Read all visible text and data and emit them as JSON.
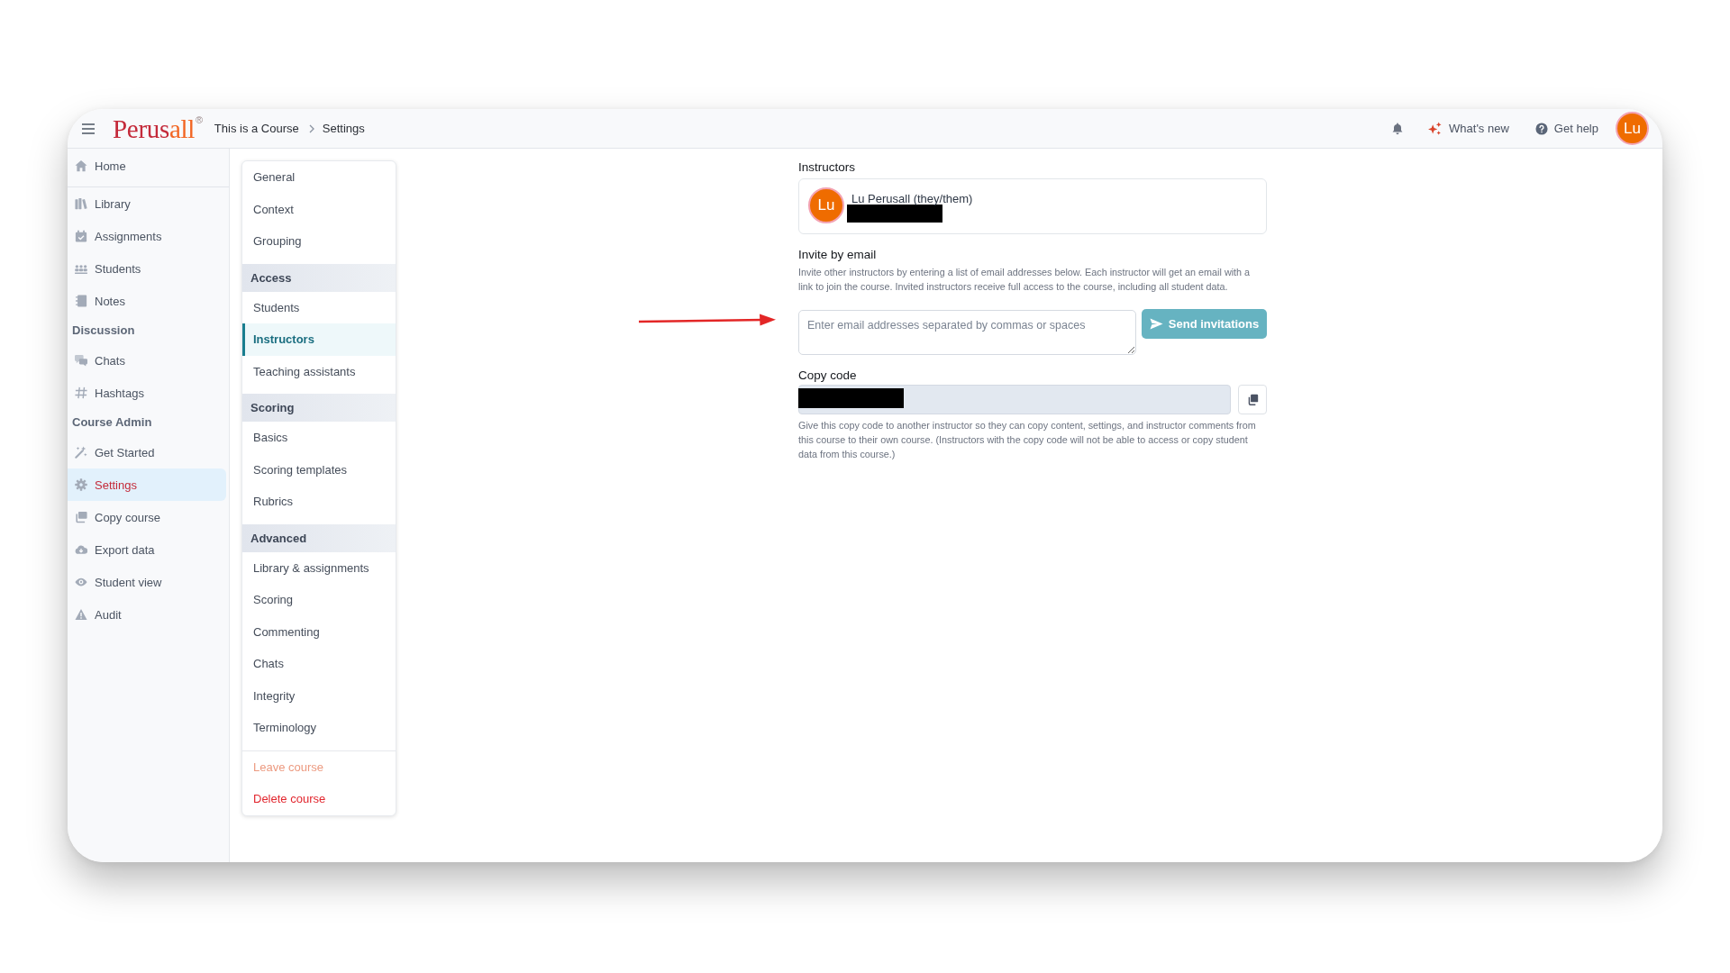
{
  "header": {
    "logo": {
      "primary": "Perus",
      "accent": "all",
      "mark": "®"
    },
    "breadcrumb": [
      "This is a Course",
      "Settings"
    ],
    "whats_new": "What's new",
    "help": "Get help",
    "avatar": "Lu"
  },
  "sidebar": {
    "groups": [
      {
        "items": [
          {
            "label": "Home",
            "selected": false
          }
        ]
      },
      {
        "items": [
          {
            "label": "Library",
            "selected": false
          },
          {
            "label": "Assignments",
            "selected": false
          },
          {
            "label": "Students",
            "selected": false
          },
          {
            "label": "Notes",
            "selected": false
          }
        ]
      },
      {
        "title": "Discussion",
        "items": [
          {
            "label": "Chats",
            "selected": false
          },
          {
            "label": "Hashtags",
            "selected": false
          }
        ]
      },
      {
        "title": "Course Admin",
        "items": [
          {
            "label": "Get Started",
            "selected": false
          },
          {
            "label": "Settings",
            "selected": true
          },
          {
            "label": "Copy course",
            "selected": false
          },
          {
            "label": "Export data",
            "selected": false
          },
          {
            "label": "Student view",
            "selected": false
          },
          {
            "label": "Audit",
            "selected": false
          }
        ]
      }
    ]
  },
  "settings_menu": {
    "sections": [
      {
        "items": [
          {
            "label": "General",
            "selected": false
          },
          {
            "label": "Context",
            "selected": false
          },
          {
            "label": "Grouping",
            "selected": false
          }
        ]
      },
      {
        "title": "Access",
        "items": [
          {
            "label": "Students",
            "selected": false
          },
          {
            "label": "Instructors",
            "selected": true
          },
          {
            "label": "Teaching assistants",
            "selected": false
          }
        ]
      },
      {
        "title": "Scoring",
        "items": [
          {
            "label": "Basics",
            "selected": false
          },
          {
            "label": "Scoring templates",
            "selected": false
          },
          {
            "label": "Rubrics",
            "selected": false
          }
        ]
      },
      {
        "title": "Advanced",
        "items": [
          {
            "label": "Library & assignments",
            "selected": false
          },
          {
            "label": "Scoring",
            "selected": false
          },
          {
            "label": "Commenting",
            "selected": false
          },
          {
            "label": "Chats",
            "selected": false
          },
          {
            "label": "Integrity",
            "selected": false
          },
          {
            "label": "Terminology",
            "selected": false
          }
        ]
      }
    ],
    "actions": [
      {
        "label": "Leave course",
        "kind": "warning"
      },
      {
        "label": "Delete course",
        "kind": "danger"
      }
    ]
  },
  "instructors": {
    "title": "Instructors",
    "members": [
      {
        "initials": "Lu",
        "name": "Lu Perusall (they/them)",
        "email_redacted": true
      }
    ]
  },
  "invite": {
    "title": "Invite by email",
    "description": "Invite other instructors by entering a list of email addresses below. Each instructor will get an email with a link to join the course. Invited instructors receive full access to the course, including all student data.",
    "field": {
      "placeholder": "Enter email addresses separated by commas or spaces"
    },
    "button": {
      "label": "Send invitations",
      "disabled": true
    }
  },
  "copy_code": {
    "title": "Copy code",
    "value_redacted": true,
    "description": "Give this copy code to another instructor so they can copy content, settings, and instructor comments from this course to their own course. (Instructors with the copy code will not be able to access or copy student data from this course.)"
  },
  "annotations": [
    {
      "kind": "arrow"
    }
  ]
}
